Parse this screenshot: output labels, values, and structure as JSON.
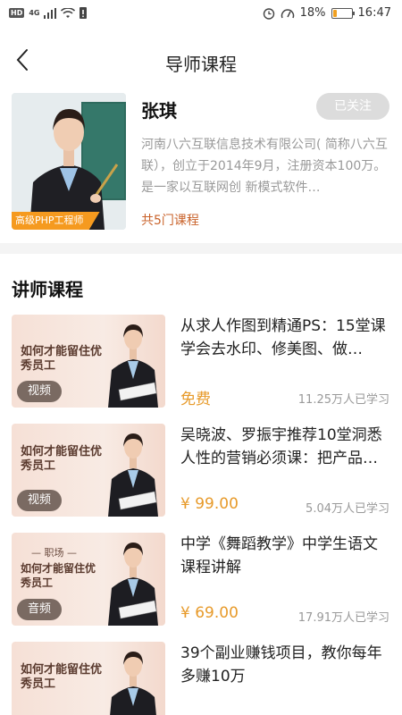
{
  "status_bar": {
    "hd": "HD",
    "network": "4G",
    "battery": "18%",
    "battery_level": 0.18,
    "time": "16:47"
  },
  "nav": {
    "title": "导师课程"
  },
  "teacher": {
    "name": "张琪",
    "follow_label": "已关注",
    "badge": "高级PHP工程师",
    "description": "河南八六互联信息技术有限公司( 简称八六互联），创立于2014年9月，注册资本100万。是一家以互联网创 新模式软件…",
    "course_count": "共5门课程"
  },
  "section_title": "讲师课程",
  "courses": [
    {
      "thumb_text": "如何才能留住优秀员工",
      "thumb_sub": "",
      "type": "视频",
      "title": "从求人作图到精通PS：15堂课学会去水印、修美图、做…",
      "price": "免费",
      "learners": "11.25万人已学习"
    },
    {
      "thumb_text": "如何才能留住优秀员工",
      "thumb_sub": "",
      "type": "视频",
      "title": "吴晓波、罗振宇推荐10堂洞悉人性的营销必须课：把产品…",
      "price": "¥ 99.00",
      "learners": "5.04万人已学习"
    },
    {
      "thumb_text": "如何才能留住优秀员工",
      "thumb_sub": "— 职场 —",
      "type": "音频",
      "title": "中学《舞蹈教学》中学生语文课程讲解",
      "price": "¥ 69.00",
      "learners": "17.91万人已学习"
    },
    {
      "thumb_text": "如何才能留住优秀员工",
      "thumb_sub": "",
      "type": "",
      "title": "39个副业赚钱项目，教你每年多赚10万",
      "price": "",
      "learners": ""
    }
  ]
}
